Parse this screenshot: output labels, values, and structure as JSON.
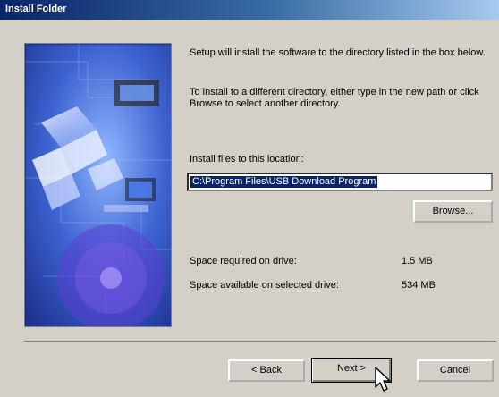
{
  "window": {
    "title": "Install Folder"
  },
  "main": {
    "intro": "Setup will install the software to the directory listed in the box below.",
    "change_hint": "To install to a different directory, either type in the new path or click Browse to select another directory.",
    "location_label": "Install files to this location:",
    "install_path": "C:\\Program Files\\USB Download Program",
    "browse_label": "Browse...",
    "space_required_label": "Space required on drive:",
    "space_required_value": "1.5 MB",
    "space_available_label": "Space available on selected drive:",
    "space_available_value": "534 MB"
  },
  "footer": {
    "back_label": "< Back",
    "next_label": "Next >",
    "cancel_label": "Cancel"
  }
}
